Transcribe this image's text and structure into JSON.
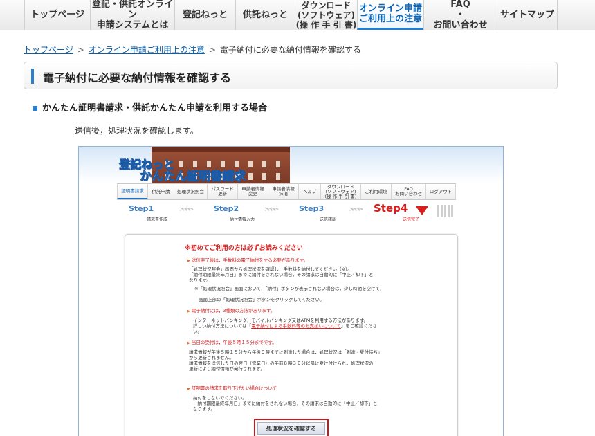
{
  "nav": {
    "items": [
      {
        "label": "トップページ"
      },
      {
        "label": "登記・供託オンライン\n申請システムとは"
      },
      {
        "label": "登記ねっと"
      },
      {
        "label": "供託ねっと"
      },
      {
        "label": "ダウンロード\n(ソフトウェア)\n(操 作 手 引 書)"
      },
      {
        "label": "オンライン申請\nご利用上の注意"
      },
      {
        "label": "FAQ\n・\nお問い合わせ"
      },
      {
        "label": "サイトマップ"
      }
    ],
    "active_index": 5
  },
  "breadcrumb": {
    "links": [
      "トップページ",
      "オンライン申請ご利用上の注意"
    ],
    "current": "電子納付に必要な納付情報を確認する",
    "separator": ">"
  },
  "page_title": "電子納付に必要な納付情報を確認する",
  "section_heading": "かんたん証明書請求・供託かんたん申請を利用する場合",
  "intro_text": "送信後，処理状況を確認します。",
  "screenshot": {
    "logo_line1": "登記ねっと",
    "logo_line2": "かんたん証明書請求",
    "nav_items": [
      "証明書請求",
      "供託申請",
      "処理状況照会",
      "パスワード\n更新",
      "申請者情報\n変更",
      "申請者情報\n抹消",
      "ヘルプ",
      "ダウンロード\n(ソフトウェア)\n(操 作 手 引 書)",
      "ご利用環境",
      "FAQ\nお問い合わせ",
      "ログアウト"
    ],
    "steps": [
      {
        "label": "Step1",
        "sub": "請求書作成"
      },
      {
        "label": "Step2",
        "sub": "納付情報入力"
      },
      {
        "label": "Step3",
        "sub": "送信確認"
      },
      {
        "label": "Step4",
        "sub": "送信完了"
      }
    ],
    "notice": {
      "title": "※初めてご利用の方は必ずお読みください",
      "h1": "送信完了後は，手数料の電子納付をする必要があります。",
      "p1": "「処理状況照会」画面から処理状況を確認し，手数料を納付してください（※）。\n「納付期限最終年月日」までに納付をされない場合，その請求は自動的に「中止／却下」と\nなります。",
      "p2": "※「処理状況照会」画面において，「納付」ボタンが表示されない場合は，少し時間を空けて，",
      "p3": "画面上部の「処理状況照会」ボタンをクリックしてください。",
      "h2": "電子納付には，3種類の方法があります。",
      "p4a": "インターネットバンキング，モバイルバンキング又はATMを利用する方法があります。",
      "p4b": "詳しい納付方法については「",
      "p4_link": "電子納付による手数料等のお支払いについて",
      "p4c": "」をご確認くださ\nい。",
      "h3": "当日の受付は，午後５時１５分までです。",
      "p5": "請求情報が午後５時１５分から午後９時までに到達した場合は，処理状況は「到達・受付待ち」\nから更新されません。\n請求情報を送信した日の翌日（営業日）の午前８時３０分以降に受け付けられ，処理状況の\n更新により納付情報が発行されます。",
      "h4": "証明書の請求を取り下げたい場合について",
      "p6": "納付をしないでください。\n「納付期限最終年月日」までに納付をされない場合，その請求は自動的に「中止／却下」と\nなります。",
      "button": "処理状況を確認する"
    }
  }
}
